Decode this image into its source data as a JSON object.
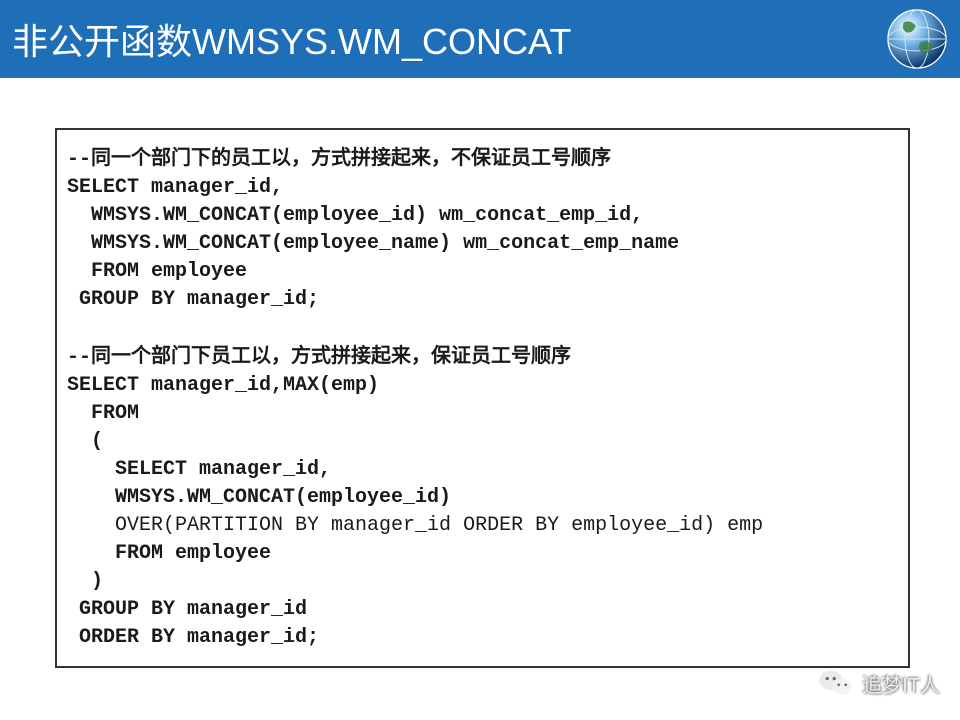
{
  "header": {
    "title": "非公开函数WMSYS.WM_CONCAT"
  },
  "code": {
    "comment1_prefix": "--",
    "comment1_text": "同一个部门下的员工以，方式拼接起来，不保证员工号顺序",
    "line2": "SELECT manager_id,",
    "line3": "  WMSYS.WM_CONCAT(employee_id) wm_concat_emp_id,",
    "line4": "  WMSYS.WM_CONCAT(employee_name) wm_concat_emp_name",
    "line5": "  FROM employee",
    "line6": " GROUP BY manager_id;",
    "comment2_prefix": "--",
    "comment2_text": "同一个部门下员工以，方式拼接起来，保证员工号顺序",
    "line8": "SELECT manager_id,MAX(emp)",
    "line9": "  FROM",
    "line10": "  (",
    "line11": "    SELECT manager_id,",
    "line12": "    WMSYS.WM_CONCAT(employee_id)",
    "line13": "    OVER(PARTITION BY manager_id ORDER BY employee_id) emp",
    "line14": "    FROM employee",
    "line15": "  )",
    "line16": " GROUP BY manager_id",
    "line17": " ORDER BY manager_id;"
  },
  "watermark": {
    "text": "追梦IT人"
  }
}
